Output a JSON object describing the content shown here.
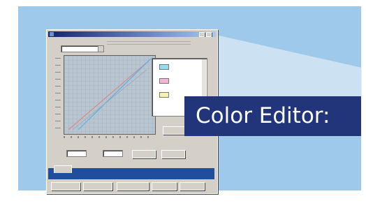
{
  "colors": {
    "background": "#9ec9ea",
    "frame": "#2d6aa0",
    "callout_fill": "#22347a",
    "callout_text": "#ffffff",
    "window_face": "#d4d0c8",
    "title_bar": "#12246b",
    "graph_bg": "#b9c6d1",
    "curve_red": "#d48c8c",
    "curve_blue": "#55b0e6"
  },
  "callout": {
    "label": "Color Editor:"
  },
  "window": {
    "title": "",
    "icon": "app-icon",
    "preset_value": "",
    "buttons": {
      "add": "",
      "remove": "",
      "first": "",
      "second": "",
      "third": "",
      "fourth": "",
      "fifth": ""
    },
    "tab_label": "",
    "input_value": "",
    "output_value": ""
  }
}
